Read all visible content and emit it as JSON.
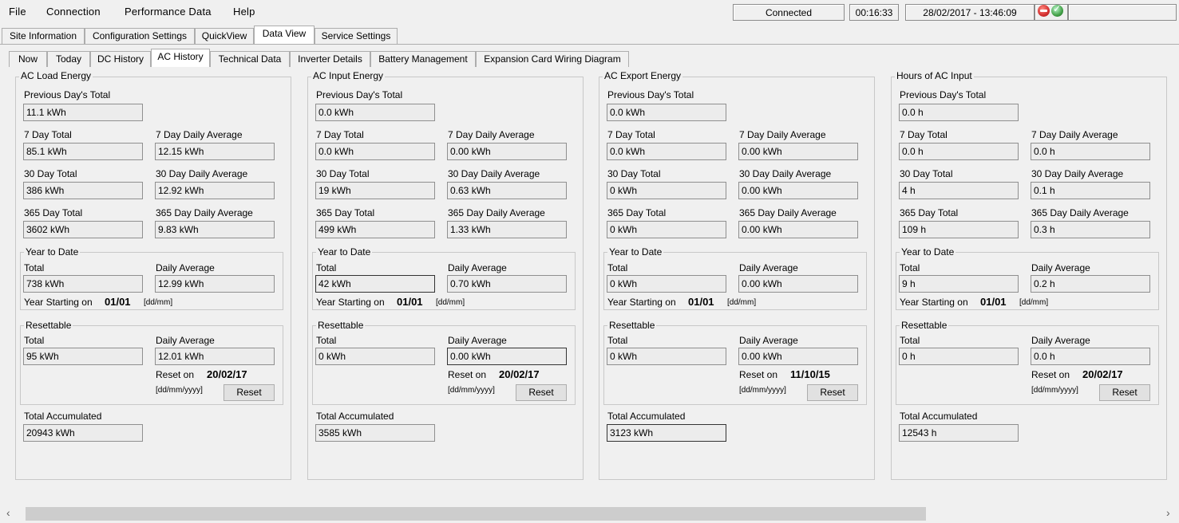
{
  "menu": {
    "items": [
      "File",
      "Connection",
      "Performance Data",
      "Help"
    ]
  },
  "status": {
    "connection": "Connected",
    "elapsed": "00:16:33",
    "datetime": "28/02/2017 - 13:46:09"
  },
  "main_tabs": [
    "Site Information",
    "Configuration Settings",
    "QuickView",
    "Data View",
    "Service Settings"
  ],
  "sub_tabs": [
    "Now",
    "Today",
    "DC History",
    "AC History",
    "Technical Data",
    "Inverter Details",
    "Battery Management",
    "Expansion Card Wiring Diagram"
  ],
  "labels": {
    "prev_day": "Previous Day's Total",
    "d7": "7 Day Total",
    "d7avg": "7 Day Daily Average",
    "d30": "30 Day Total",
    "d30avg": "30 Day Daily Average",
    "d365": "365 Day Total",
    "d365avg": "365 Day Daily Average",
    "ytd": "Year to Date",
    "total": "Total",
    "daily_avg": "Daily Average",
    "year_starting": "Year Starting on",
    "ddmm": "[dd/mm]",
    "resettable": "Resettable",
    "reset_on": "Reset on",
    "ddmmyyyy": "[dd/mm/yyyy]",
    "reset": "Reset",
    "accumulated": "Total Accumulated"
  },
  "panels": [
    {
      "title": "AC Load Energy",
      "prev_day": "11.1 kWh",
      "d7": "85.1 kWh",
      "d7avg": "12.15 kWh",
      "d30": "386 kWh",
      "d30avg": "12.92 kWh",
      "d365": "3602 kWh",
      "d365avg": "9.83 kWh",
      "ytd_total": "738 kWh",
      "ytd_avg": "12.99 kWh",
      "year_start": "01/01",
      "res_total": "95 kWh",
      "res_avg": "12.01 kWh",
      "reset_date": "20/02/17",
      "accumulated": "20943 kWh"
    },
    {
      "title": "AC Input Energy",
      "prev_day": "0.0 kWh",
      "d7": "0.0 kWh",
      "d7avg": "0.00 kWh",
      "d30": "19 kWh",
      "d30avg": "0.63 kWh",
      "d365": "499 kWh",
      "d365avg": "1.33 kWh",
      "ytd_total": "42 kWh",
      "ytd_avg": "0.70 kWh",
      "year_start": "01/01",
      "res_total": "0 kWh",
      "res_avg": "0.00 kWh",
      "reset_date": "20/02/17",
      "accumulated": "3585 kWh"
    },
    {
      "title": "AC Export Energy",
      "prev_day": "0.0 kWh",
      "d7": "0.0 kWh",
      "d7avg": "0.00 kWh",
      "d30": "0 kWh",
      "d30avg": "0.00 kWh",
      "d365": "0 kWh",
      "d365avg": "0.00 kWh",
      "ytd_total": "0 kWh",
      "ytd_avg": "0.00 kWh",
      "year_start": "01/01",
      "res_total": "0 kWh",
      "res_avg": "0.00 kWh",
      "reset_date": "11/10/15",
      "accumulated": "3123 kWh"
    },
    {
      "title": "Hours of AC Input",
      "prev_day": "0.0 h",
      "d7": "0.0 h",
      "d7avg": "0.0 h",
      "d30": "4 h",
      "d30avg": "0.1 h",
      "d365": "109 h",
      "d365avg": "0.3 h",
      "ytd_total": "9 h",
      "ytd_avg": "0.2 h",
      "year_start": "01/01",
      "res_total": "0 h",
      "res_avg": "0.0 h",
      "reset_date": "20/02/17",
      "accumulated": "12543 h"
    }
  ],
  "colors": {
    "window_bg": "#f0f0f0",
    "active_tab_bg": "#ffffff",
    "status_red": "#d32f2f",
    "status_green": "#43a047"
  }
}
